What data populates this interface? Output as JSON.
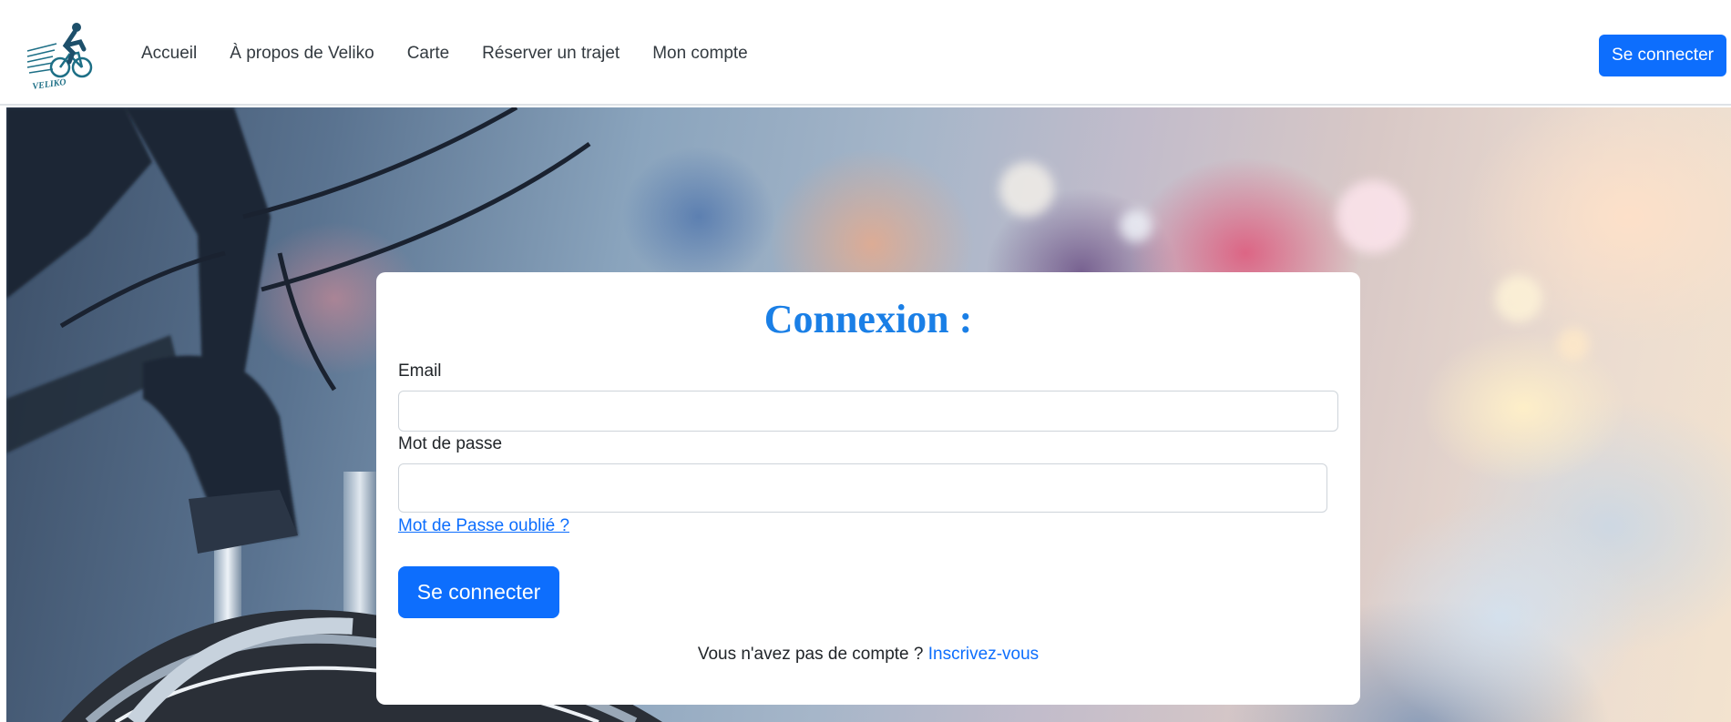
{
  "navbar": {
    "logo_text": "VELIKO",
    "links": [
      {
        "label": "Accueil"
      },
      {
        "label": "À propos de Veliko"
      },
      {
        "label": "Carte"
      },
      {
        "label": "Réserver un trajet"
      },
      {
        "label": "Mon compte"
      }
    ],
    "login_button": "Se connecter"
  },
  "login": {
    "title": "Connexion :",
    "email_label": "Email",
    "email_value": "",
    "password_label": "Mot de passe",
    "password_value": "",
    "forgot_link": "Mot de Passe oublié ?",
    "submit": "Se connecter",
    "no_account_text": "Vous n'avez pas de compte ?",
    "register_link": "Inscrivez-vous"
  },
  "colors": {
    "primary": "#0d6efd",
    "title": "#1a7fe6",
    "nav_text": "#333a40"
  }
}
